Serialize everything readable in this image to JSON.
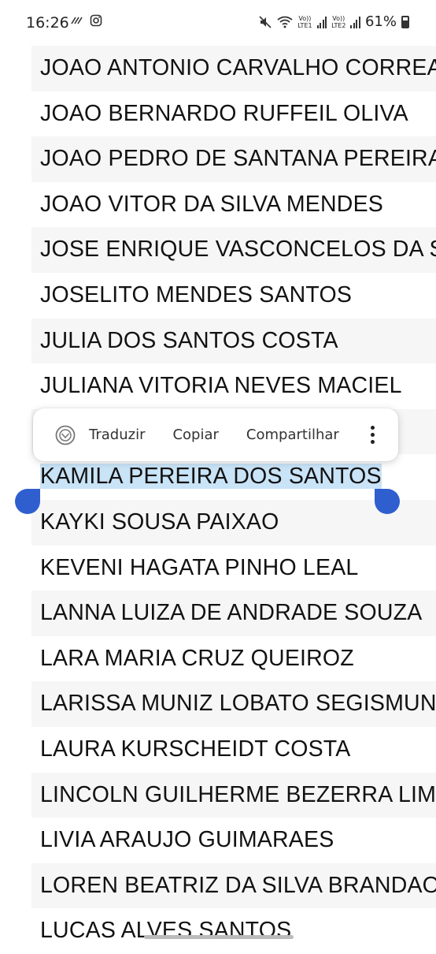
{
  "status_bar": {
    "time": "16:26",
    "lte1": "LTE1",
    "lte2": "LTE2",
    "vo1": "Vo))",
    "vo2": "Vo))",
    "battery": "61%"
  },
  "context_menu": {
    "translate_label": "Traduzir",
    "copy_label": "Copiar",
    "share_label": "Compartilhar"
  },
  "names": [
    "JOAO ANTONIO CARVALHO CORREA",
    "JOAO BERNARDO RUFFEIL OLIVA",
    "JOAO PEDRO DE SANTANA PEREIRA",
    "JOAO VITOR DA SILVA MENDES",
    "JOSE ENRIQUE VASCONCELOS DA SI",
    "JOSELITO MENDES SANTOS",
    "JULIA DOS SANTOS COSTA",
    "JULIANA VITORIA NEVES MACIEL",
    "",
    "KAMILA PEREIRA DOS SANTOS",
    "KAYKI SOUSA PAIXAO",
    "KEVENI HAGATA PINHO LEAL",
    "LANNA LUIZA DE ANDRADE SOUZA",
    "LARA MARIA CRUZ QUEIROZ",
    "LARISSA MUNIZ LOBATO SEGISMUND",
    "LAURA KURSCHEIDT COSTA",
    "LINCOLN GUILHERME BEZERRA LIMA",
    "LIVIA ARAUJO GUIMARAES",
    "LOREN BEATRIZ DA SILVA BRANDAO",
    "LUCAS ALVES SANTOS"
  ]
}
